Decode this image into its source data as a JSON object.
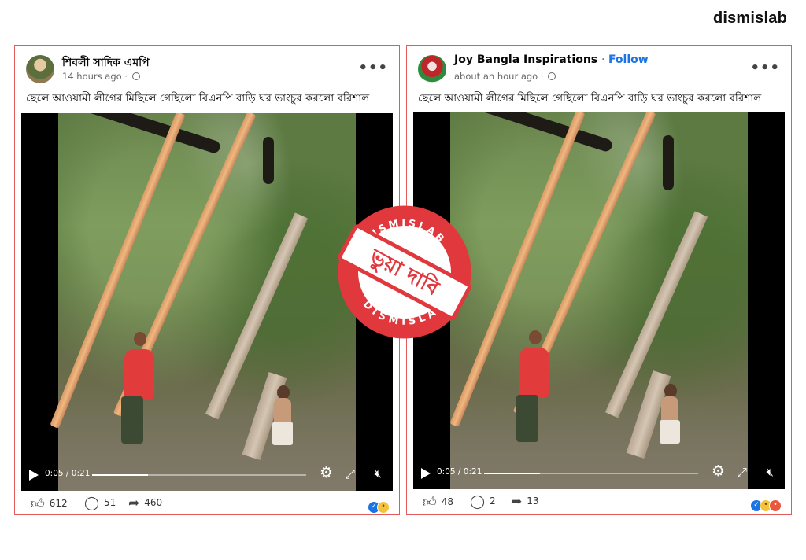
{
  "brand": {
    "name": "dismislab"
  },
  "stamp": {
    "top_text": "DISMISLAB",
    "bottom_text": "DISMISLAB",
    "label": "ভুয়া দাবি",
    "color": "#e0383d"
  },
  "posts": [
    {
      "author": "শিবলী সাদিক এমপি",
      "follow": "",
      "time": "14 hours ago ·",
      "caption": "ছেলে আওয়ামী লীগের মিছিলে গেছিলো বিএনপি বাড়ি ঘর ভাংচুর করলো বরিশাল",
      "video": {
        "time": "0:05 / 0:21",
        "progress": 0.26
      },
      "likes": "612",
      "comments": "51",
      "shares": "460",
      "reactions": [
        "like",
        "sad"
      ]
    },
    {
      "author": "Joy Bangla Inspirations",
      "follow": "Follow",
      "time": "about an hour ago ·",
      "caption": "ছেলে আওয়ামী লীগের মিছিলে গেছিলো বিএনপি বাড়ি ঘর ভাংচুর করলো বরিশাল",
      "video": {
        "time": "0:05 / 0:21",
        "progress": 0.26
      },
      "likes": "48",
      "comments": "2",
      "shares": "13",
      "reactions": [
        "like",
        "sad",
        "angry"
      ]
    }
  ],
  "icons": [
    "like-icon",
    "comment-icon",
    "share-icon",
    "play-icon",
    "settings-icon",
    "fullscreen-icon",
    "mute-icon",
    "more-icon",
    "globe-icon"
  ]
}
